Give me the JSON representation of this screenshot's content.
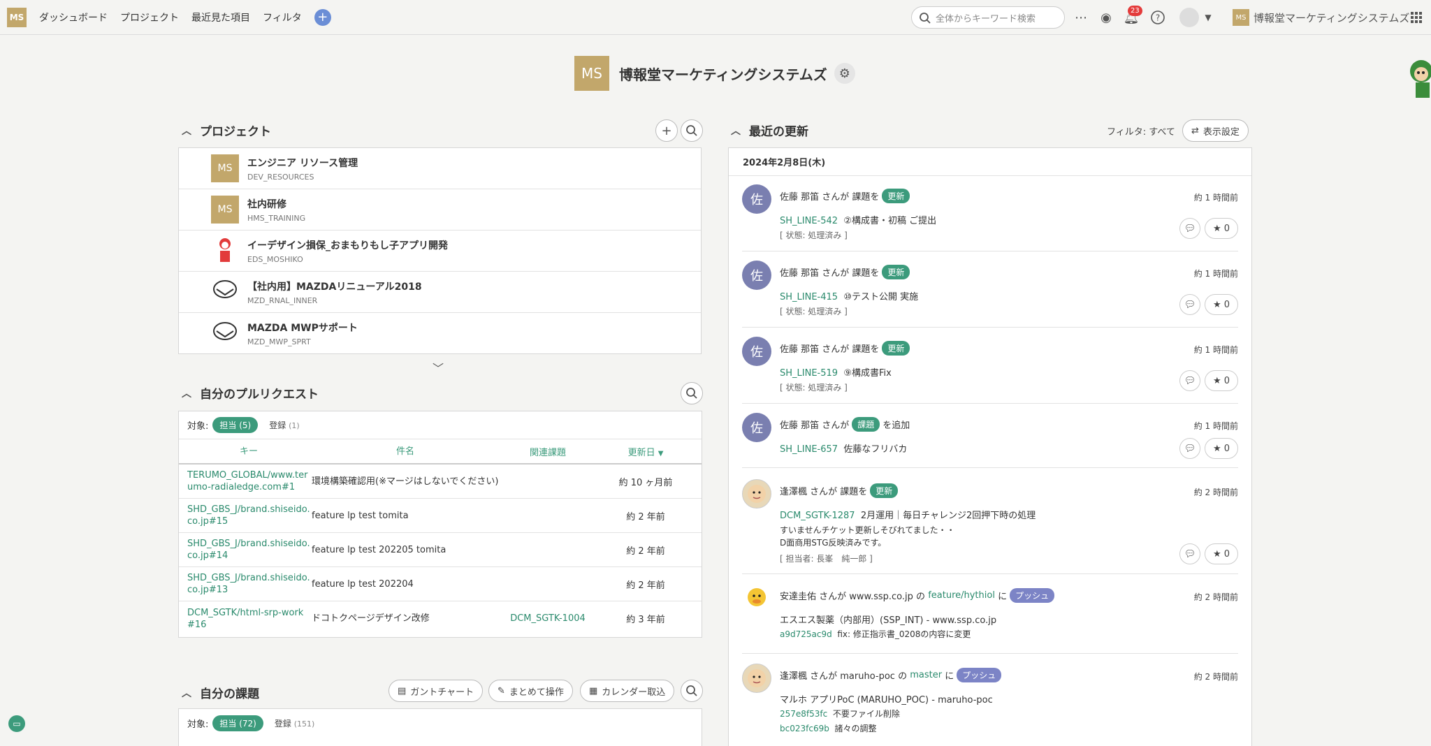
{
  "topnav": {
    "logo": "MS",
    "links": [
      "ダッシュボード",
      "プロジェクト",
      "最近見た項目",
      "フィルタ"
    ],
    "search_placeholder": "全体からキーワード検索",
    "notif_count": "23",
    "space_logo": "MS",
    "space_name": "博報堂マーケティングシステムズ"
  },
  "header": {
    "logo": "MS",
    "title": "博報堂マーケティングシステムズ"
  },
  "projects": {
    "title": "プロジェクト",
    "items": [
      {
        "name": "エンジニア リソース管理",
        "key": "DEV_RESOURCES",
        "icon": "MS"
      },
      {
        "name": "社内研修",
        "key": "HMS_TRAINING",
        "icon": "MS"
      },
      {
        "name": "イーデザイン損保_おまもりもし子アプリ開発",
        "key": "EDS_MOSHIKO",
        "icon": ""
      },
      {
        "name": "【社内用】MAZDAリニューアル2018",
        "key": "MZD_RNAL_INNER",
        "icon": "mazda"
      },
      {
        "name": "MAZDA MWPサポート",
        "key": "MZD_MWP_SPRT",
        "icon": "mazda"
      }
    ]
  },
  "pullrequests": {
    "title": "自分のプルリクエスト",
    "filter_label": "対象:",
    "tab_active": "担当",
    "tab_active_count": "(5)",
    "tab_other": "登録",
    "tab_other_count": "(1)",
    "columns": [
      "キー",
      "件名",
      "関連課題",
      "更新日"
    ],
    "rows": [
      {
        "key": "TERUMO_GLOBAL/www.terumo-radialedge.com#1",
        "title": "環境構築確認用(※マージはしないでください)",
        "related": "",
        "date": "約 10 ヶ月前"
      },
      {
        "key": "SHD_GBS_J/brand.shiseido.co.jp#15",
        "title": "feature lp test tomita",
        "related": "",
        "date": "約 2 年前"
      },
      {
        "key": "SHD_GBS_J/brand.shiseido.co.jp#14",
        "title": "feature lp test 202205 tomita",
        "related": "",
        "date": "約 2 年前"
      },
      {
        "key": "SHD_GBS_J/brand.shiseido.co.jp#13",
        "title": "feature lp test 202204",
        "related": "",
        "date": "約 2 年前"
      },
      {
        "key": "DCM_SGTK/html-srp-work#16",
        "title": "ドコトクページデザイン改修",
        "related": "DCM_SGTK-1004",
        "date": "約 3 年前"
      }
    ]
  },
  "myissues": {
    "title": "自分の課題",
    "gantt": "ガントチャート",
    "bulk": "まとめて操作",
    "calendar": "カレンダー取込",
    "filter_label": "対象:",
    "tab_active": "担当",
    "tab_active_count": "(72)",
    "tab_other": "登録",
    "tab_other_count": "(151)"
  },
  "updates": {
    "title": "最近の更新",
    "filter": "フィルタ: すべて",
    "settings": "表示設定",
    "date": "2024年2月8日(木)",
    "items": [
      {
        "avatar": "佐",
        "who": "佐藤 那笛 さんが 課題を",
        "tag": "更新",
        "time": "約 1 時間前",
        "key": "SH_LINE-542",
        "summary": "②構成書・初稿 ご提出",
        "status": "[ 状態: 処理済み ]",
        "stars": "0"
      },
      {
        "avatar": "佐",
        "who": "佐藤 那笛 さんが 課題を",
        "tag": "更新",
        "time": "約 1 時間前",
        "key": "SH_LINE-415",
        "summary": "⑩テスト公開 実施",
        "status": "[ 状態: 処理済み ]",
        "stars": "0"
      },
      {
        "avatar": "佐",
        "who": "佐藤 那笛 さんが 課題を",
        "tag": "更新",
        "time": "約 1 時間前",
        "key": "SH_LINE-519",
        "summary": "⑨構成書Fix",
        "status": "[ 状態: 処理済み ]",
        "stars": "0"
      },
      {
        "avatar": "佐",
        "who": "佐藤 那笛 さんが",
        "tag": "課題",
        "after": "を追加",
        "time": "約 1 時間前",
        "key": "SH_LINE-657",
        "summary": "佐藤なフリバカ",
        "stars": "0"
      },
      {
        "who": "逢澤楓 さんが 課題を",
        "tag": "更新",
        "time": "約 2 時間前",
        "key": "DCM_SGTK-1287",
        "summary": "2月運用｜毎日チャレンジ2回押下時の処理",
        "comment1": "すいませんチケット更新しそびれてました・・",
        "comment2": "D面商用STG反映済みです。",
        "status": "[ 担当者: 長峯　純一郎 ]",
        "stars": "0"
      },
      {
        "who": "安達圭佑 さんが www.ssp.co.jp の",
        "branch": "feature/hythiol",
        "mid": "に",
        "tag": "プッシュ",
        "time": "約 2 時間前",
        "repo": "エスエス製薬（内部用）(SSP_INT) - www.ssp.co.jp",
        "commit": "a9d725ac9d",
        "commit_msg": "fix: 修正指示書_0208の内容に変更"
      },
      {
        "who": "逢澤楓 さんが maruho-poc の",
        "branch": "master",
        "mid": "に",
        "tag": "プッシュ",
        "time": "約 2 時間前",
        "repo": "マルホ アプリPoC (MARUHO_POC) - maruho-poc",
        "commit": "257e8f53fc",
        "commit_msg": "不要ファイル削除",
        "commit2": "bc023fc69b",
        "commit_msg2": "諸々の調整"
      }
    ]
  }
}
